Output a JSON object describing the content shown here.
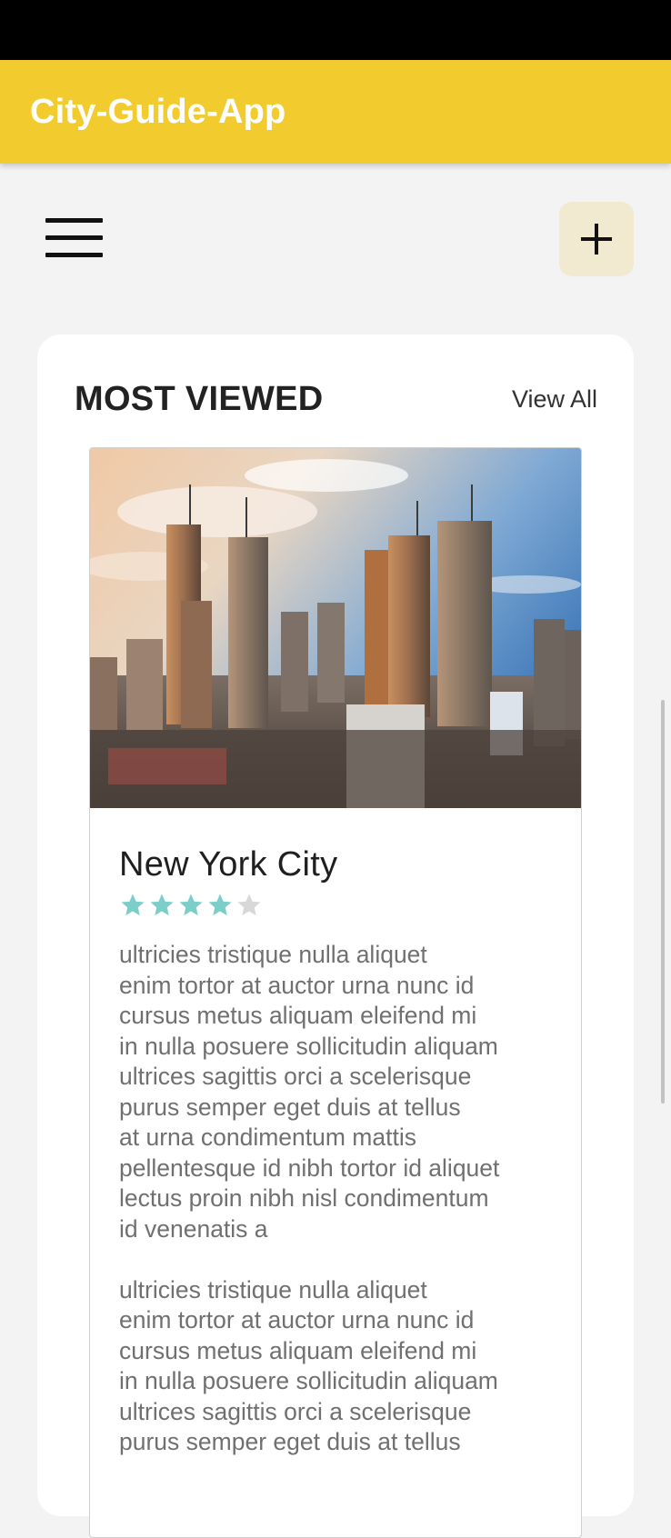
{
  "app": {
    "title": "City-Guide-App"
  },
  "toolbar": {
    "menu_icon": "hamburger-menu-icon",
    "add_icon": "plus-icon"
  },
  "section": {
    "title": "MOST VIEWED",
    "view_all_label": "View All"
  },
  "card": {
    "title": "New York City",
    "rating": 4,
    "rating_max": 5,
    "star_color_filled": "#7ccfc9",
    "star_color_empty": "#d8d8d8",
    "description": "ultricies tristique nulla aliquet\nenim tortor at auctor urna nunc id\ncursus metus aliquam eleifend mi\nin nulla posuere sollicitudin aliquam\nultrices sagittis orci a scelerisque\npurus semper eget duis at tellus\nat urna condimentum mattis\npellentesque id nibh tortor id aliquet\nlectus proin nibh nisl condimentum\nid venenatis a\n\nultricies tristique nulla aliquet\nenim tortor at auctor urna nunc id\ncursus metus aliquam eleifend mi\nin nulla posuere sollicitudin aliquam\nultrices sagittis orci a scelerisque\npurus semper eget duis at tellus"
  },
  "colors": {
    "app_bar": "#f2cc2f",
    "add_button_bg": "#f1ead0",
    "background": "#f3f3f3"
  }
}
